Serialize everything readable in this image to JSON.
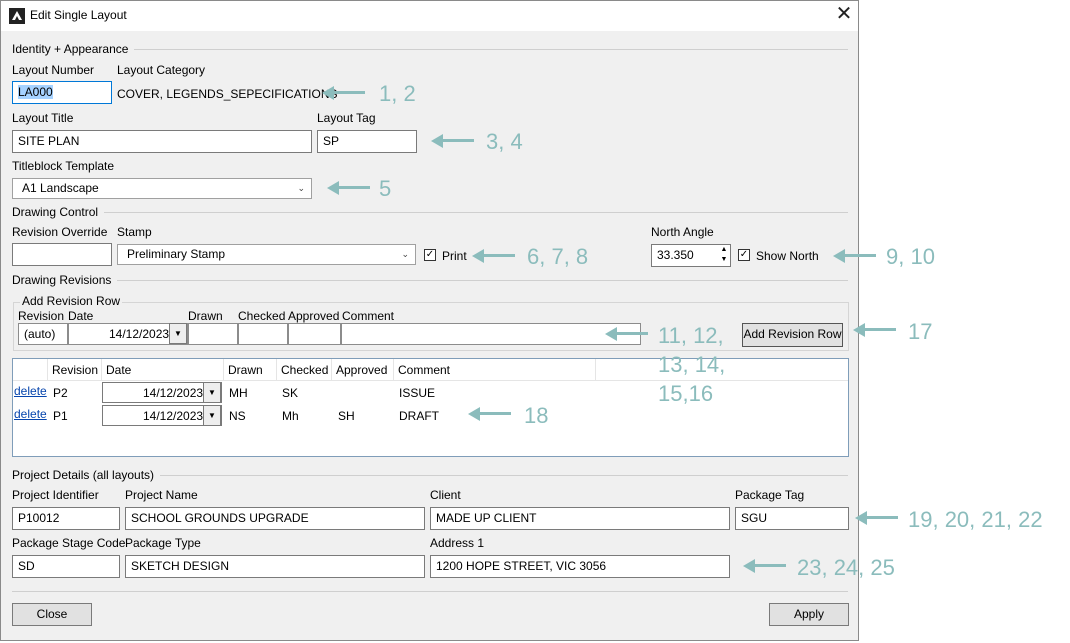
{
  "window": {
    "title": "Edit Single Layout",
    "close_glyph": "✕"
  },
  "identity": {
    "group": "Identity + Appearance",
    "layout_number_label": "Layout Number",
    "layout_number_value": "LA000",
    "layout_category_label": "Layout Category",
    "layout_category_value": "COVER, LEGENDS_SEPECIFICATIONS",
    "layout_title_label": "Layout Title",
    "layout_title_value": "SITE PLAN",
    "layout_tag_label": "Layout Tag",
    "layout_tag_value": "SP",
    "titleblock_label": "Titleblock Template",
    "titleblock_value": "A1 Landscape"
  },
  "drawing_control": {
    "group": "Drawing Control",
    "revision_override_label": "Revision Override",
    "revision_override_value": "",
    "stamp_label": "Stamp",
    "stamp_value": "Preliminary Stamp",
    "print_label": "Print",
    "print_checked": true,
    "north_angle_label": "North Angle",
    "north_angle_value": "33.350",
    "show_north_label": "Show North",
    "show_north_checked": true
  },
  "drawing_revisions": {
    "group": "Drawing Revisions",
    "add_row_group": "Add Revision Row",
    "headers": {
      "revision": "Revision",
      "date": "Date",
      "drawn": "Drawn",
      "checked": "Checked",
      "approved": "Approved",
      "comment": "Comment"
    },
    "new_row": {
      "revision": "(auto)",
      "date": "14/12/2023",
      "drawn": "",
      "checked": "",
      "approved": "",
      "comment": ""
    },
    "add_button": "Add Revision Row",
    "table_headers": [
      "",
      "Revision",
      "Date",
      "Drawn",
      "Checked",
      "Approved",
      "Comment"
    ],
    "rows": [
      {
        "action": "delete",
        "revision": "P2",
        "date": "14/12/2023",
        "drawn": "MH",
        "checked": "SK",
        "approved": "",
        "comment": "ISSUE"
      },
      {
        "action": "delete",
        "revision": "P1",
        "date": "14/12/2023",
        "drawn": "NS",
        "checked": "Mh",
        "approved": "SH",
        "comment": "DRAFT"
      }
    ]
  },
  "project": {
    "group": "Project Details (all layouts)",
    "project_identifier_label": "Project Identifier",
    "project_identifier_value": "P10012",
    "project_name_label": "Project Name",
    "project_name_value": "SCHOOL GROUNDS UPGRADE",
    "client_label": "Client",
    "client_value": "MADE UP CLIENT",
    "package_tag_label": "Package Tag",
    "package_tag_value": "SGU",
    "package_stage_label": "Package Stage Code",
    "package_stage_value": "SD",
    "package_type_label": "Package Type",
    "package_type_value": "SKETCH DESIGN",
    "address_label": "Address 1",
    "address_value": "1200 HOPE STREET, VIC 3056"
  },
  "footer": {
    "close": "Close",
    "apply": "Apply"
  },
  "annotations": {
    "a1": "1, 2",
    "a2": "3, 4",
    "a3": "5",
    "a4": "6, 7, 8",
    "a5": "9, 10",
    "a6_l1": "11, 12,",
    "a6_l2": "13, 14,",
    "a6_l3": "15,16",
    "a7": "17",
    "a8": "18",
    "a9": "19, 20, 21, 22",
    "a10": "23, 24, 25"
  },
  "colors": {
    "annotation": "#8bbcbc",
    "link": "#0645ad"
  }
}
